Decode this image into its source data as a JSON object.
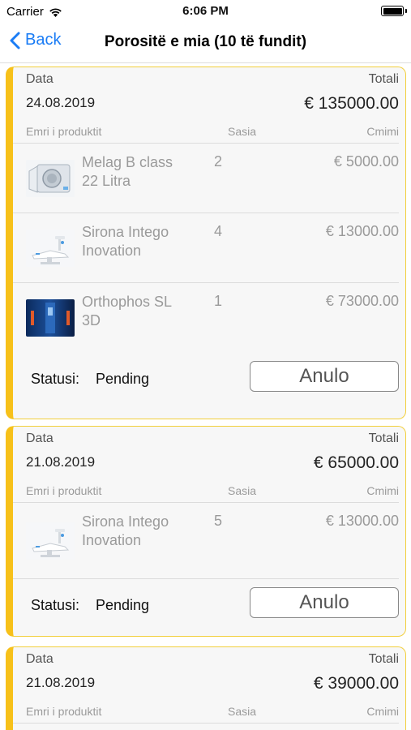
{
  "status_bar": {
    "carrier": "Carrier",
    "time": "6:06 PM"
  },
  "nav": {
    "back_label": "Back",
    "title": "Porositë e mia (10 të fundit)"
  },
  "labels": {
    "date": "Data",
    "total": "Totali",
    "product_name": "Emri i produktit",
    "quantity": "Sasia",
    "price": "Cmimi",
    "status": "Statusi:",
    "cancel": "Anulo"
  },
  "orders": [
    {
      "date": "24.08.2019",
      "total": "€ 135000.00",
      "status": "Pending",
      "items": [
        {
          "name": "Melag B class 22 Litra",
          "qty": "2",
          "price": "€ 5000.00",
          "image_icon": "autoclave-icon"
        },
        {
          "name": "Sirona Intego Inovation",
          "qty": "4",
          "price": "€ 13000.00",
          "image_icon": "dental-chair-icon"
        },
        {
          "name": "Orthophos SL 3D",
          "qty": "1",
          "price": "€ 73000.00",
          "image_icon": "xray-unit-icon"
        }
      ]
    },
    {
      "date": "21.08.2019",
      "total": "€ 65000.00",
      "status": "Pending",
      "items": [
        {
          "name": "Sirona Intego Inovation",
          "qty": "5",
          "price": "€ 13000.00",
          "image_icon": "dental-chair-icon"
        }
      ]
    },
    {
      "date": "21.08.2019",
      "total": "€ 39000.00",
      "status": "",
      "items": []
    }
  ],
  "colors": {
    "accent": "#1a7cf5",
    "card_border": "#f2cf3c",
    "card_stripe": "#f7c11a"
  }
}
